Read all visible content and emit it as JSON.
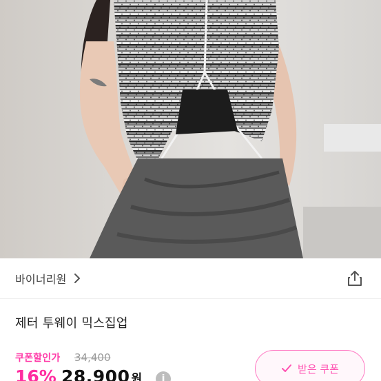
{
  "store": {
    "name": "바이너리원"
  },
  "product": {
    "title": "제터 투웨이 믹스집업"
  },
  "price": {
    "coupon_label": "쿠폰할인가",
    "original": "34,400",
    "discount": "16%",
    "final": "28,900",
    "currency": "원"
  },
  "coupon_button": {
    "label": "받은 쿠폰"
  },
  "icons": {
    "store_chevron": "chevron-right-icon",
    "share": "share-icon",
    "info": "info-icon",
    "check": "check-icon"
  },
  "colors": {
    "accent_pink": "#ff2da0",
    "strike_gray": "#9a9a9a",
    "text_dark": "#222222"
  }
}
